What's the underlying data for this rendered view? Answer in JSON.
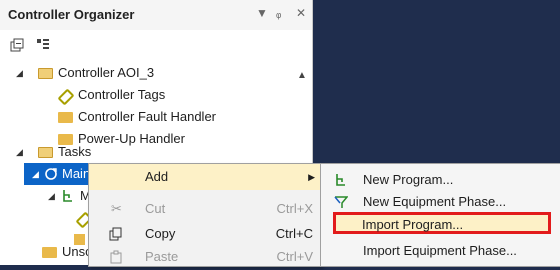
{
  "panel": {
    "title": "Controller Organizer",
    "controls": [
      "▼",
      "ᵩ",
      "✕"
    ]
  },
  "tree": {
    "controller": "Controller AOI_3",
    "tags": "Controller Tags",
    "fault": "Controller Fault Handler",
    "powerup": "Power-Up Handler",
    "tasks": "Tasks",
    "maintask": "MainT",
    "mainprog": "Ma",
    "unsch": "Unsch"
  },
  "menu": {
    "add": "Add",
    "cut": "Cut",
    "cut_short": "Ctrl+X",
    "copy": "Copy",
    "copy_short": "Ctrl+C",
    "paste": "Paste",
    "paste_short": "Ctrl+V"
  },
  "submenu": {
    "new_program": "New Program...",
    "new_phase": "New Equipment Phase...",
    "import_program": "Import Program...",
    "import_phase": "Import Equipment Phase..."
  },
  "colors": {
    "accent": "#0c64c7",
    "highlight": "#fdf1c7",
    "focus_border": "#e21b1b",
    "background": "#1f2d4d"
  }
}
